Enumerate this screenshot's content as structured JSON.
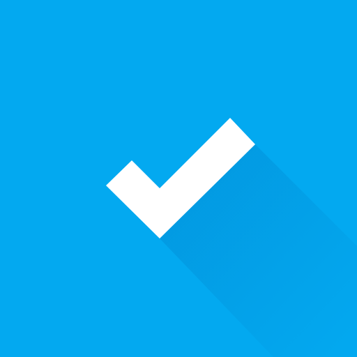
{
  "icon": {
    "name": "checkmark-icon",
    "shape": "check",
    "style": "flat long-shadow"
  },
  "colors": {
    "background": "#03a9f0",
    "checkmark": "#ffffff",
    "shadow": "#0288d1"
  }
}
